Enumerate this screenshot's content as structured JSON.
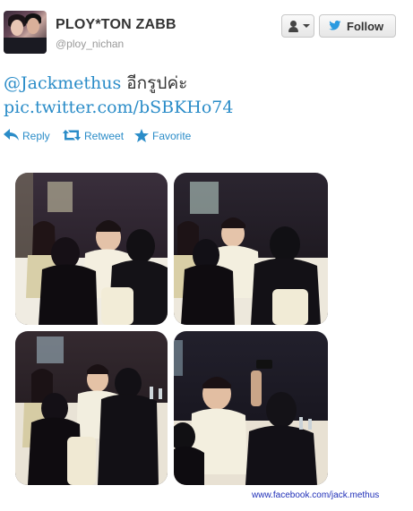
{
  "user": {
    "display_name": "PLOY*TON ZABB",
    "screen_name": "@ploy_nichan"
  },
  "header_buttons": {
    "follow_label": "Follow",
    "user_menu_icon": "user-dropdown-icon"
  },
  "tweet": {
    "mention": "@Jackmethus",
    "text_thai": " อีกรูปค่ะ",
    "link": "pic.twitter.com/bSBKHo74"
  },
  "actions": {
    "reply": "Reply",
    "retweet": "Retweet",
    "favorite": "Favorite"
  },
  "photos": [
    {
      "name": "photo-1"
    },
    {
      "name": "photo-2"
    },
    {
      "name": "photo-3"
    },
    {
      "name": "photo-4"
    }
  ],
  "footer": {
    "credit": "www.facebook.com/jack.methus"
  },
  "colors": {
    "link": "#2a8cc8",
    "footer": "#1f2fb8",
    "name": "#333333",
    "handle": "#999999"
  }
}
